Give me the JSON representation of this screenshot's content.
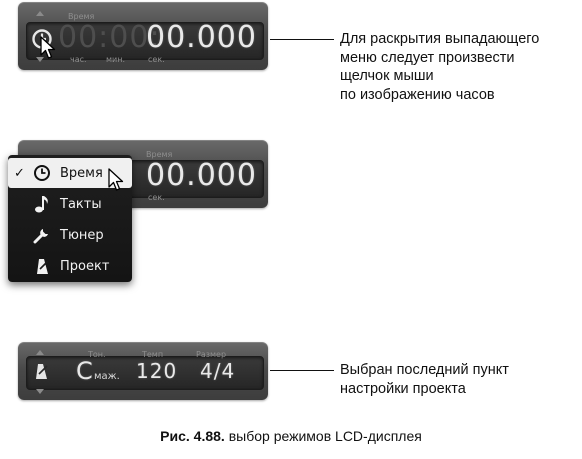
{
  "panel1": {
    "top_label": "Время",
    "dim_digits": "00:00:",
    "bright_digits": "00.000",
    "unit_hours": "час.",
    "unit_minutes": "мин.",
    "unit_seconds": "сек."
  },
  "annotation1": {
    "lines": [
      "Для раскрытия выпадающего",
      "меню следует произвести",
      "щелчок мыши",
      "по изображению часов"
    ]
  },
  "panel2": {
    "top_label": "Время",
    "bright_digits": "00.000",
    "unit_seconds": "сек."
  },
  "menu": {
    "items": [
      {
        "label": "Время",
        "icon": "clock-icon",
        "checked": true
      },
      {
        "label": "Такты",
        "icon": "note-icon",
        "checked": false
      },
      {
        "label": "Тюнер",
        "icon": "wrench-icon",
        "checked": false
      },
      {
        "label": "Проект",
        "icon": "metronome-icon",
        "checked": false
      }
    ],
    "check_mark": "✓"
  },
  "panel3": {
    "tone_label": "Тон.",
    "tempo_label": "Темп",
    "size_label": "Размер",
    "tone_value": "C",
    "tone_suffix": "маж.",
    "tempo_value": "120",
    "size_value": "4/4"
  },
  "annotation2": {
    "lines": [
      "Выбран последний пункт",
      "настройки проекта"
    ]
  },
  "caption": {
    "prefix": "Рис. 4.88.",
    "text": " выбор режимов LCD-дисплея"
  },
  "colors": {
    "lcd_bright": "#e9e9e9",
    "lcd_dim": "#4e4e4e",
    "menu_bg": "#1a1a1a",
    "menu_selected_bg": "#f0f0f0"
  }
}
